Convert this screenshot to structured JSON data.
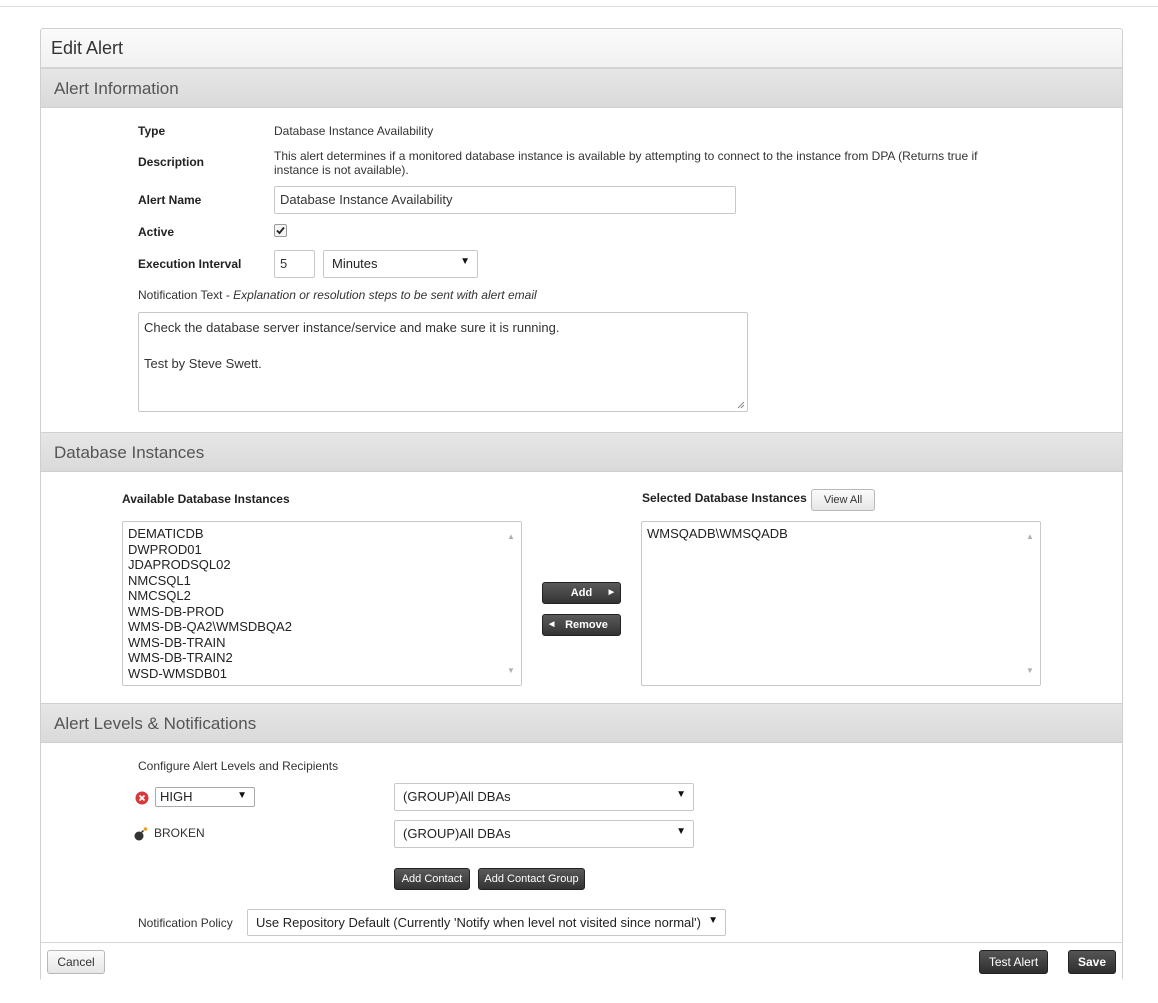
{
  "panel": {
    "title": "Edit Alert"
  },
  "alert_info": {
    "header": "Alert Information",
    "type_label": "Type",
    "type_value": "Database Instance Availability",
    "description_label": "Description",
    "description_value": "This alert determines if a monitored database instance is available by attempting to connect to the instance from DPA (Returns true if instance is not available).",
    "name_label": "Alert Name",
    "name_value": "Database Instance Availability",
    "active_label": "Active",
    "active_checked": true,
    "interval_label": "Execution Interval",
    "interval_value": "5",
    "interval_unit": "Minutes",
    "notification_label": "Notification Text - ",
    "notification_hint": "Explanation or resolution steps to be sent with alert email",
    "notification_line1": "Check the database server instance/service and make sure it is running.",
    "notification_line2": "Test by Steve Swett."
  },
  "db_instances": {
    "header": "Database Instances",
    "available_label": "Available Database Instances",
    "selected_label": "Selected Database Instances",
    "view_all_label": "View All",
    "available": [
      "DEMATICDB",
      "DWPROD01",
      "JDAPRODSQL02",
      "NMCSQL1",
      "NMCSQL2",
      "WMS-DB-PROD",
      "WMS-DB-QA2\\WMSDBQA2",
      "WMS-DB-TRAIN",
      "WMS-DB-TRAIN2",
      "WSD-WMSDB01"
    ],
    "selected": [
      "WMSQADB\\WMSQADB"
    ],
    "add_label": "Add",
    "remove_label": "Remove"
  },
  "levels": {
    "header": "Alert Levels & Notifications",
    "configure_label": "Configure Alert Levels and Recipients",
    "high_level": "HIGH",
    "high_recipient": "(GROUP)All DBAs",
    "broken_label": "BROKEN",
    "broken_recipient": "(GROUP)All DBAs",
    "add_contact_label": "Add Contact",
    "add_contact_group_label": "Add Contact Group",
    "policy_label": "Notification Policy",
    "policy_value": "Use Repository Default (Currently 'Notify when level not visited since normal')"
  },
  "footer": {
    "cancel_label": "Cancel",
    "test_alert_label": "Test Alert",
    "save_label": "Save"
  },
  "colors": {
    "high_icon": "#d9383a",
    "broken_spark": "#f0a020"
  }
}
